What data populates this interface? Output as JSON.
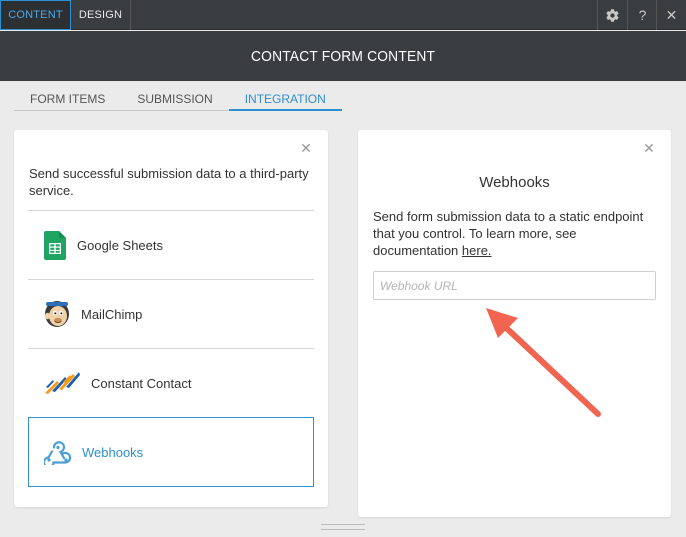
{
  "topbar": {
    "tabs": [
      "CONTENT",
      "DESIGN"
    ],
    "active_tab": "CONTENT",
    "icons": [
      "gear-icon",
      "help-icon",
      "close-icon"
    ],
    "help_label": "?",
    "close_label": "✕"
  },
  "header": {
    "title": "CONTACT FORM CONTENT"
  },
  "subtabs": {
    "items": [
      "FORM ITEMS",
      "SUBMISSION",
      "INTEGRATION"
    ],
    "active": "INTEGRATION"
  },
  "left_panel": {
    "intro": "Send successful submission data to a third-party service.",
    "services": [
      {
        "label": "Google Sheets",
        "icon": "google-sheets-icon"
      },
      {
        "label": "MailChimp",
        "icon": "mailchimp-icon"
      },
      {
        "label": "Constant Contact",
        "icon": "constant-contact-icon"
      },
      {
        "label": "Webhooks",
        "icon": "webhooks-icon",
        "selected": true
      }
    ]
  },
  "right_panel": {
    "title": "Webhooks",
    "description": "Send form submission data to a static endpoint that you control. To learn more, see documentation ",
    "link_text": "here.",
    "input_placeholder": "Webhook URL",
    "input_value": ""
  },
  "colors": {
    "accent": "#2e8fd1",
    "topbar": "#3a3d3f",
    "background": "#ebebeb",
    "arrow": "#f06450",
    "sheets_green": "#1fa463"
  }
}
